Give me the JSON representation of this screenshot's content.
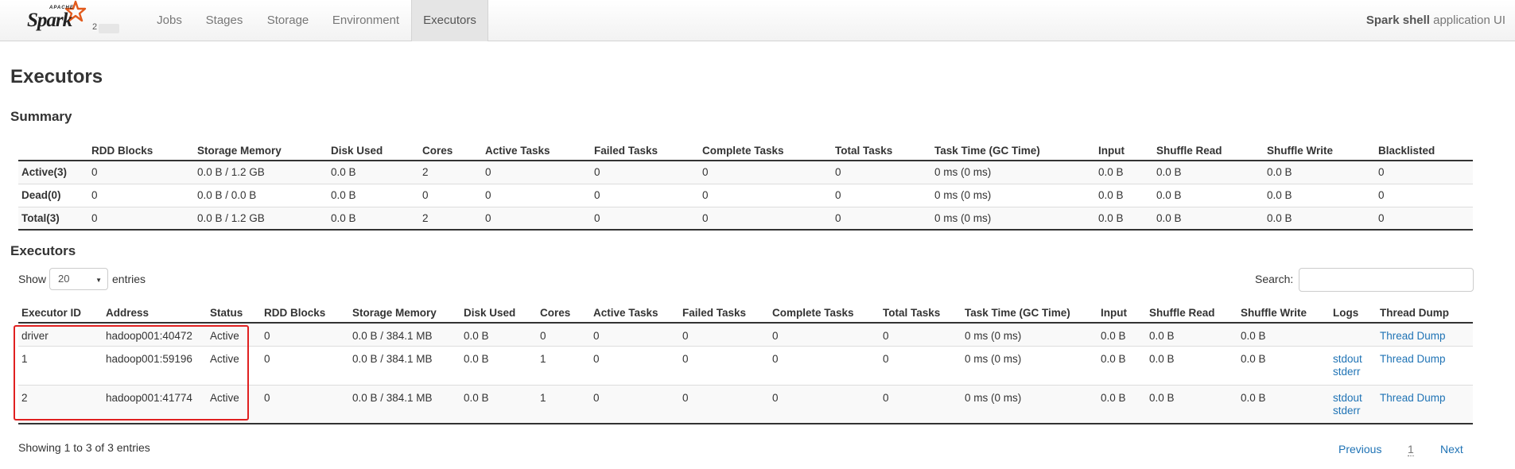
{
  "navbar": {
    "logo": {
      "apache": "APACHE",
      "spark": "Spark",
      "version": "2"
    },
    "tabs": [
      "Jobs",
      "Stages",
      "Storage",
      "Environment",
      "Executors"
    ],
    "active_tab": "Executors",
    "app_title_bold": "Spark shell",
    "app_title_rest": " application UI"
  },
  "page_title": "Executors",
  "summary": {
    "heading": "Summary",
    "columns": [
      "",
      "RDD Blocks",
      "Storage Memory",
      "Disk Used",
      "Cores",
      "Active Tasks",
      "Failed Tasks",
      "Complete Tasks",
      "Total Tasks",
      "Task Time (GC Time)",
      "Input",
      "Shuffle Read",
      "Shuffle Write",
      "Blacklisted"
    ],
    "rows": [
      [
        "Active(3)",
        "0",
        "0.0 B / 1.2 GB",
        "0.0 B",
        "2",
        "0",
        "0",
        "0",
        "0",
        "0 ms (0 ms)",
        "0.0 B",
        "0.0 B",
        "0.0 B",
        "0"
      ],
      [
        "Dead(0)",
        "0",
        "0.0 B / 0.0 B",
        "0.0 B",
        "0",
        "0",
        "0",
        "0",
        "0",
        "0 ms (0 ms)",
        "0.0 B",
        "0.0 B",
        "0.0 B",
        "0"
      ],
      [
        "Total(3)",
        "0",
        "0.0 B / 1.2 GB",
        "0.0 B",
        "2",
        "0",
        "0",
        "0",
        "0",
        "0 ms (0 ms)",
        "0.0 B",
        "0.0 B",
        "0.0 B",
        "0"
      ]
    ]
  },
  "executors": {
    "heading": "Executors",
    "show_label": "Show",
    "page_size": "20",
    "entries_label": "entries",
    "search_label": "Search:",
    "search_value": "",
    "columns": [
      "Executor ID",
      "Address",
      "Status",
      "RDD Blocks",
      "Storage Memory",
      "Disk Used",
      "Cores",
      "Active Tasks",
      "Failed Tasks",
      "Complete Tasks",
      "Total Tasks",
      "Task Time (GC Time)",
      "Input",
      "Shuffle Read",
      "Shuffle Write",
      "Logs",
      "Thread Dump"
    ],
    "rows": [
      {
        "cells": [
          "driver",
          "hadoop001:40472",
          "Active",
          "0",
          "0.0 B / 384.1 MB",
          "0.0 B",
          "0",
          "0",
          "0",
          "0",
          "0",
          "0 ms (0 ms)",
          "0.0 B",
          "0.0 B",
          "0.0 B"
        ],
        "logs": [],
        "thread_dump": "Thread Dump"
      },
      {
        "cells": [
          "1",
          "hadoop001:59196",
          "Active",
          "0",
          "0.0 B / 384.1 MB",
          "0.0 B",
          "1",
          "0",
          "0",
          "0",
          "0",
          "0 ms (0 ms)",
          "0.0 B",
          "0.0 B",
          "0.0 B"
        ],
        "logs": [
          "stdout",
          "stderr"
        ],
        "thread_dump": "Thread Dump"
      },
      {
        "cells": [
          "2",
          "hadoop001:41774",
          "Active",
          "0",
          "0.0 B / 384.1 MB",
          "0.0 B",
          "1",
          "0",
          "0",
          "0",
          "0",
          "0 ms (0 ms)",
          "0.0 B",
          "0.0 B",
          "0.0 B"
        ],
        "logs": [
          "stdout",
          "stderr"
        ],
        "thread_dump": "Thread Dump"
      }
    ],
    "info": "Showing 1 to 3 of 3 entries",
    "pagination": {
      "previous": "Previous",
      "current": "1",
      "next": "Next"
    }
  },
  "colors": {
    "link": "#1f73b5",
    "highlight_box": "#e02020",
    "spark_star": "#e25a1c"
  }
}
